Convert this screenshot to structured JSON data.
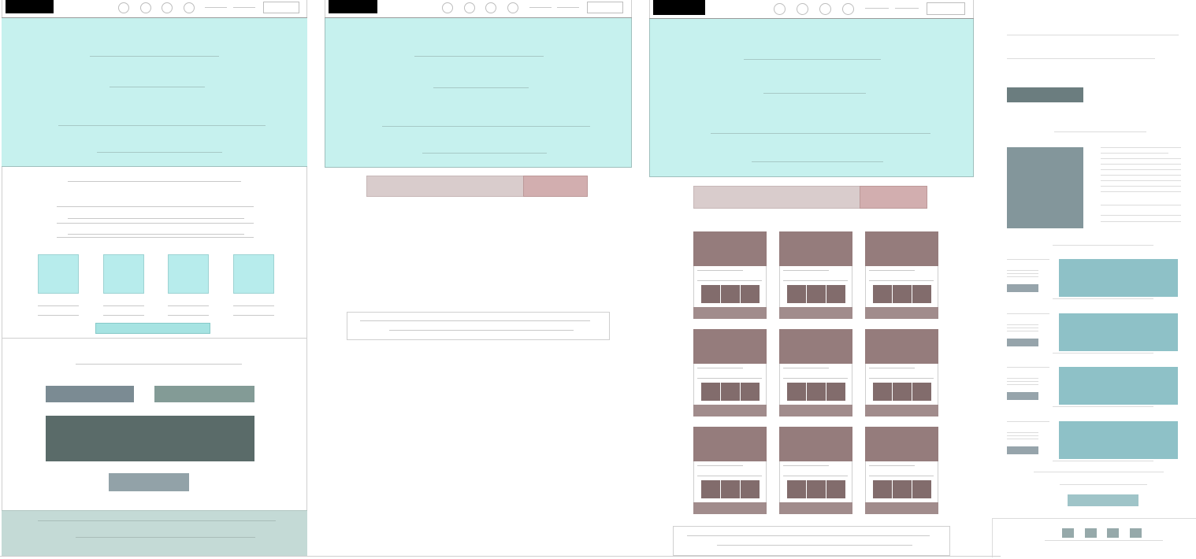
{
  "page": {
    "description_text": ""
  },
  "colors": {
    "hero": "#c6f1ee",
    "tile": "#b7ecec",
    "cta_teal": "#a6e3e2",
    "slate": "#7b8b93",
    "sage": "#839b96",
    "dark_slate": "#5a6b69",
    "light_slate": "#92a2a8",
    "footer_sage": "#c4dad6",
    "rose_input": "#d9cccc",
    "rose_button": "#d2aeaf",
    "card_top": "#957c7c",
    "card_thumb": "#826c6c",
    "card_bar": "#a18c8c",
    "article_button": "#6b7d7f",
    "article_image": "#83969b",
    "list_image": "#8ec1c7",
    "list_tag": "#96a4ab",
    "list_cta": "#9fc4c8",
    "footer_square": "#96a9aa"
  },
  "wireframes": {
    "home": {
      "name": "home-wireframe"
    },
    "search": {
      "name": "search-wireframe"
    },
    "results": {
      "name": "results-wireframe"
    },
    "article": {
      "name": "article-wireframe"
    }
  }
}
